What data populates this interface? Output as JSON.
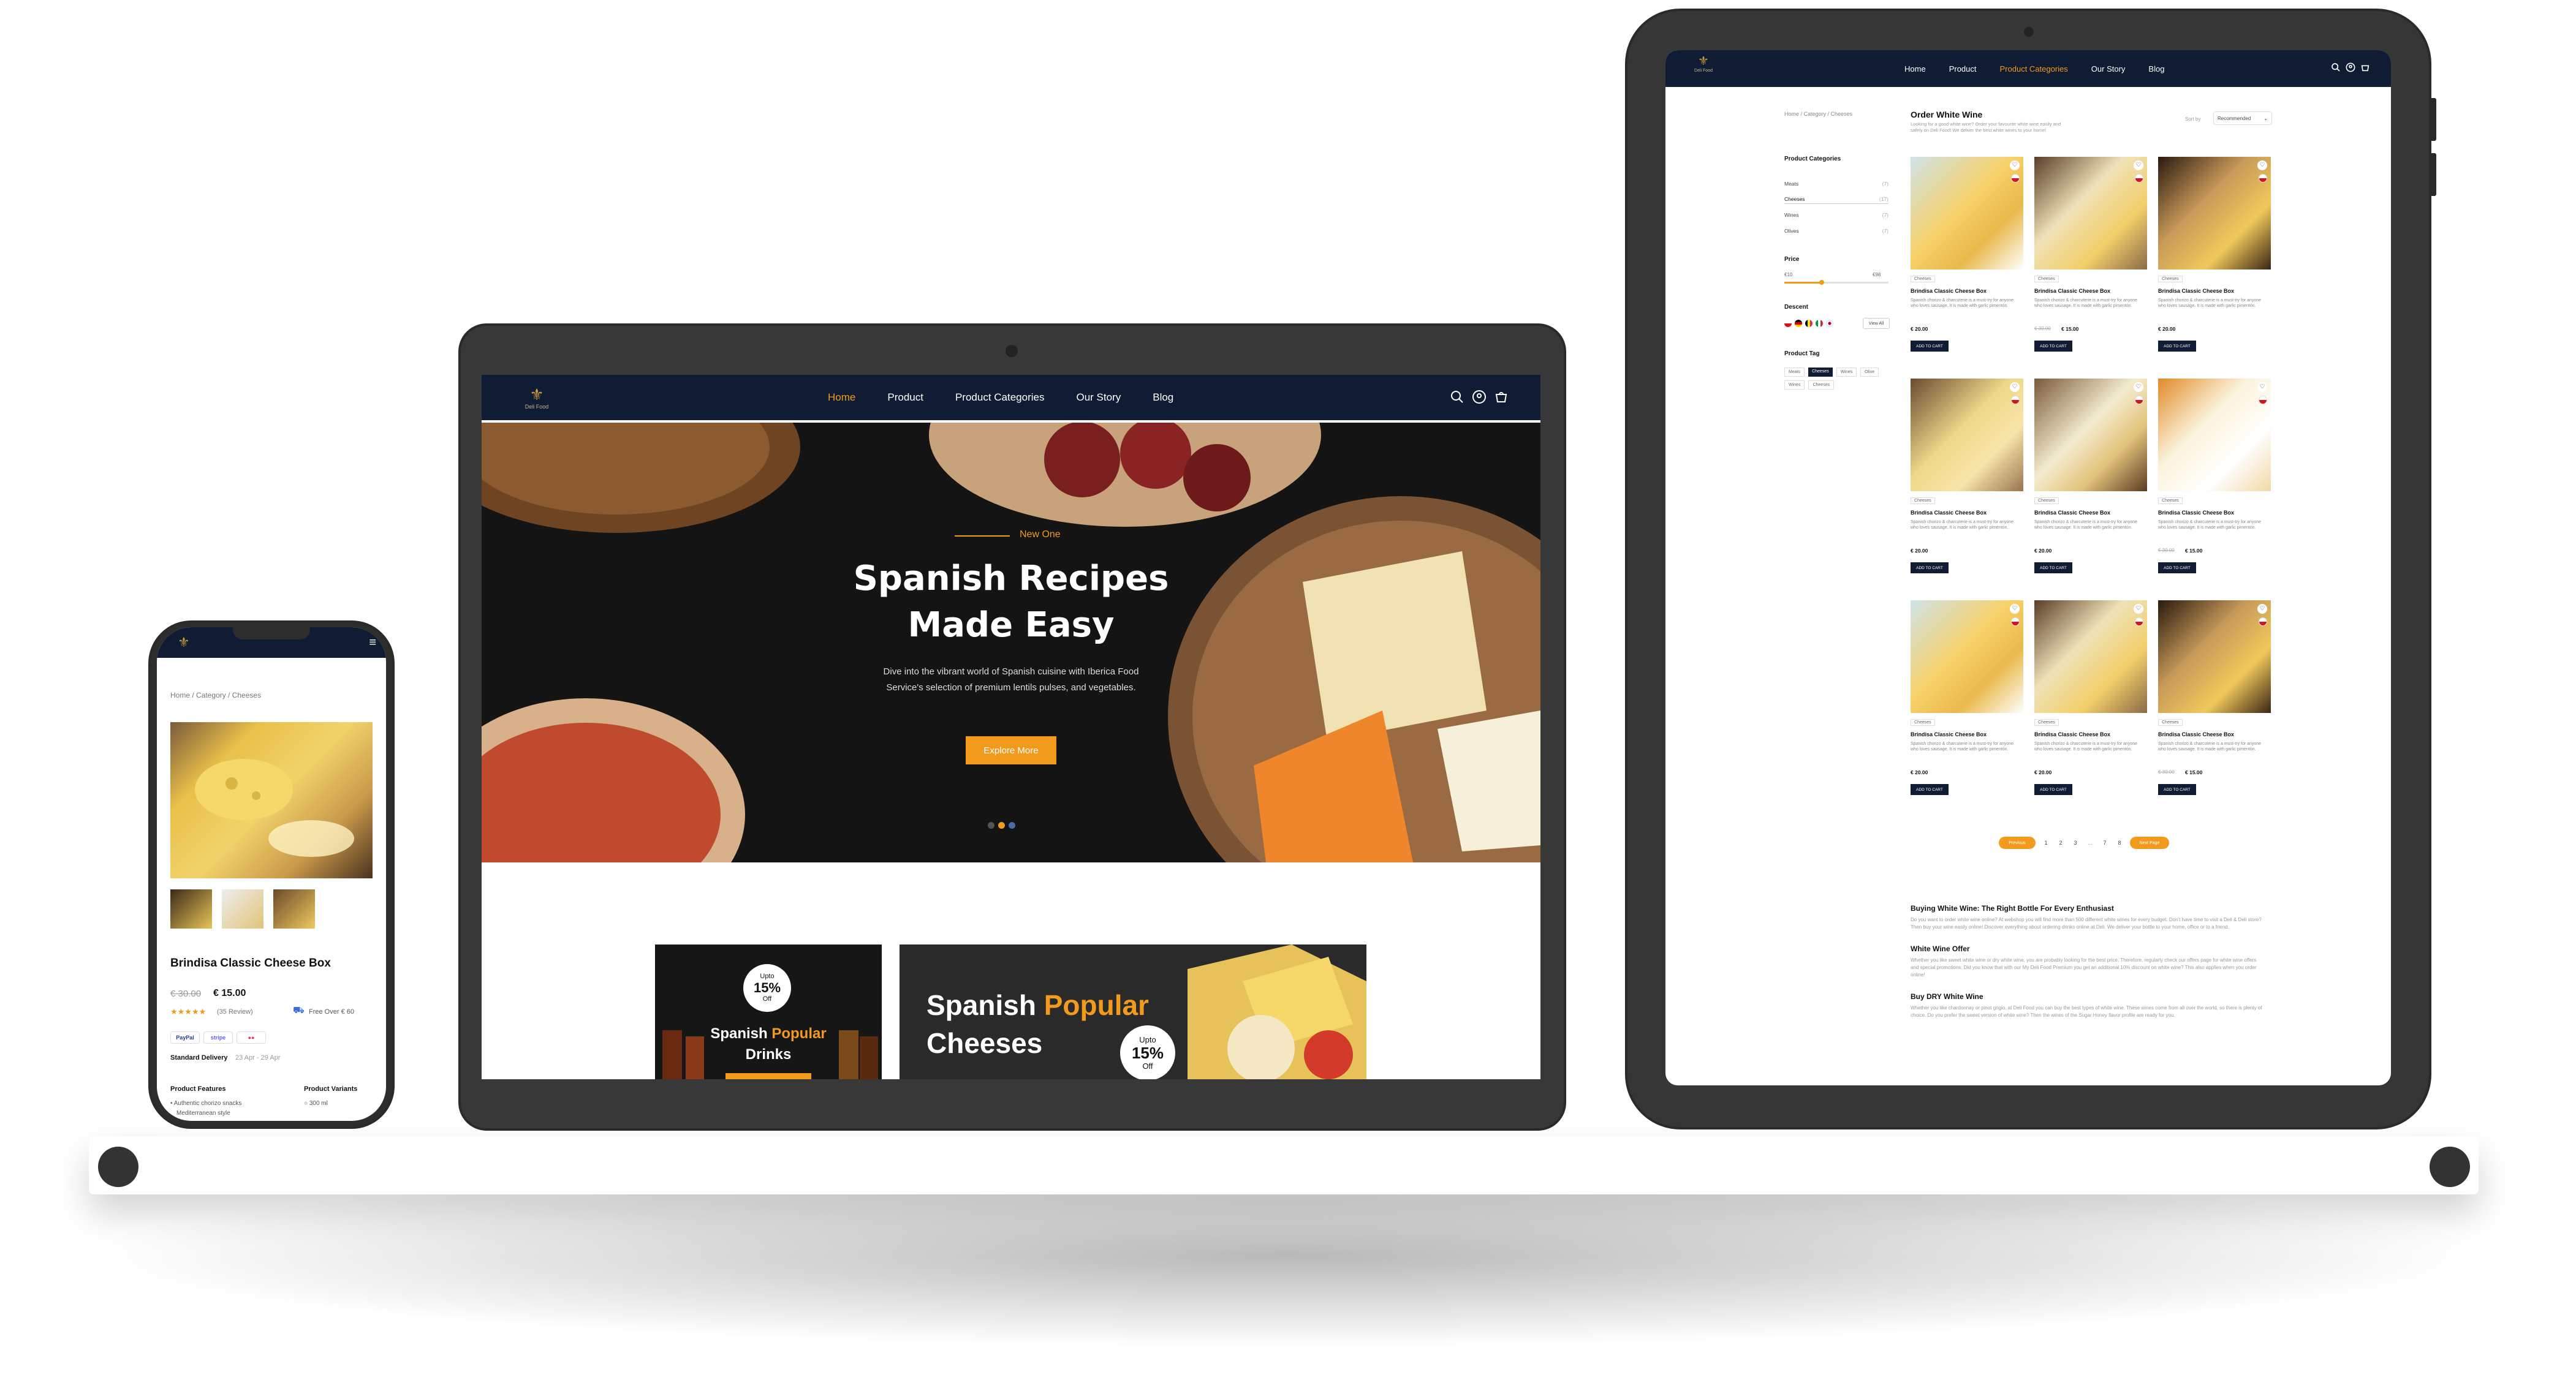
{
  "colors": {
    "navy": "#0f1c33",
    "accent": "#f29a1c",
    "frame": "#3a3a3a",
    "bodyText": "#8a8a8a"
  },
  "brand": {
    "name": "Deli Food",
    "logo_icon": "crest-logo-icon"
  },
  "nav": {
    "items": [
      "Home",
      "Product",
      "Product Categories",
      "Our Story",
      "Blog"
    ],
    "active_laptop": 0,
    "active_tablet": 2
  },
  "hero": {
    "eyebrow": "New One",
    "title_line1": "Spanish Recipes",
    "title_line2": "Made Easy",
    "desc": "Dive into the vibrant world of Spanish cuisine with Iberica Food Service's selection of premium lentils pulses, and vegetables.",
    "cta": "Explore More",
    "slides": 3,
    "active_slide": 1
  },
  "promos": [
    {
      "title_a": "Spanish ",
      "title_b": "Popular",
      "title_c": "Drinks",
      "badge_top": "Upto",
      "badge_pct": "15%",
      "badge_bottom": "Off"
    },
    {
      "title_a": "Spanish ",
      "title_b": "Popular",
      "title_c": "Cheeses",
      "badge_top": "Upto",
      "badge_pct": "15%",
      "badge_bottom": "Off"
    }
  ],
  "mobile": {
    "breadcrumb": "Home / Category / Cheeses",
    "product_title": "Brindisa Classic Cheese Box",
    "old_price": "€ 30.00",
    "price": "€ 15.00",
    "stars": "★★★★★",
    "reviews": "(35 Review)",
    "shipping": "Free Over € 60",
    "payments": [
      "PayPal",
      "stripe",
      "●●"
    ],
    "delivery_label": "Standard Delivery",
    "delivery_date": "23 Apr - 29 Apr",
    "features_label": "Product Features",
    "variants_label": "Product Variants",
    "feature_1": "Authentic chorizo snacks",
    "feature_2": "Mediterranean style",
    "variant_1": "300 ml"
  },
  "shop": {
    "breadcrumb": "Home / Category / Cheeses",
    "title": "Order White Wine",
    "intro": "Looking for a good white wine? Order your favourite white wine easily and safely on Deli Food! We deliver the best white wines to your home!",
    "sort_label": "Sort by",
    "sort_value": "Recommended",
    "categories_label": "Product Categories",
    "categories": [
      {
        "name": "Meats",
        "count": "(7)"
      },
      {
        "name": "Cheeses",
        "count": "(17)"
      },
      {
        "name": "Wines",
        "count": "(7)"
      },
      {
        "name": "Olives",
        "count": "(7)"
      }
    ],
    "price_label": "Price",
    "price_min": "€10",
    "price_max": "€98",
    "descent_label": "Descent",
    "view_all": "View All",
    "tag_label": "Product Tag",
    "tags": [
      "Meats",
      "Cheeses",
      "Wines",
      "Olive",
      "Wines",
      "Cheeses"
    ],
    "products": [
      {
        "cat": "Cheeses",
        "name": "Brindisa Classic Cheese Box",
        "desc": "Spanish chorizo & charcuterie is a must-try for anyone who loves sausage. It is made with garlic pimentón.",
        "old": "",
        "price": "€ 20.00",
        "cta": "ADD TO CART"
      },
      {
        "cat": "Cheeses",
        "name": "Brindisa Classic Cheese Box",
        "desc": "Spanish chorizo & charcuterie is a must-try for anyone who loves sausage. It is made with garlic pimentón.",
        "old": "€ 30.00",
        "price": "€ 15.00",
        "cta": "ADD TO CART"
      },
      {
        "cat": "Cheeses",
        "name": "Brindisa Classic Cheese Box",
        "desc": "Spanish chorizo & charcuterie is a must-try for anyone who loves sausage. It is made with garlic pimentón.",
        "old": "",
        "price": "€ 20.00",
        "cta": "ADD TO CART"
      },
      {
        "cat": "Cheeses",
        "name": "Brindisa Classic Cheese Box",
        "desc": "Spanish chorizo & charcuterie is a must-try for anyone who loves sausage. It is made with garlic pimentón.",
        "old": "",
        "price": "€ 20.00",
        "cta": "ADD TO CART"
      },
      {
        "cat": "Cheeses",
        "name": "Brindisa Classic Cheese Box",
        "desc": "Spanish chorizo & charcuterie is a must-try for anyone who loves sausage. It is made with garlic pimentón.",
        "old": "",
        "price": "€ 20.00",
        "cta": "ADD TO CART"
      },
      {
        "cat": "Cheeses",
        "name": "Brindisa Classic Cheese Box",
        "desc": "Spanish chorizo & charcuterie is a must-try for anyone who loves sausage. It is made with garlic pimentón.",
        "old": "€ 30.00",
        "price": "€ 15.00",
        "cta": "ADD TO CART"
      },
      {
        "cat": "Cheeses",
        "name": "Brindisa Classic Cheese Box",
        "desc": "Spanish chorizo & charcuterie is a must-try for anyone who loves sausage. It is made with garlic pimentón.",
        "old": "",
        "price": "€ 20.00",
        "cta": "ADD TO CART"
      },
      {
        "cat": "Cheeses",
        "name": "Brindisa Classic Cheese Box",
        "desc": "Spanish chorizo & charcuterie is a must-try for anyone who loves sausage. It is made with garlic pimentón.",
        "old": "",
        "price": "€ 20.00",
        "cta": "ADD TO CART"
      },
      {
        "cat": "Cheeses",
        "name": "Brindisa Classic Cheese Box",
        "desc": "Spanish chorizo & charcuterie is a must-try for anyone who loves sausage. It is made with garlic pimentón.",
        "old": "€ 30.00",
        "price": "€ 15.00",
        "cta": "ADD TO CART"
      }
    ],
    "pagination": {
      "prev": "Previous",
      "pages": [
        "1",
        "2",
        "3",
        "...",
        "7",
        "8"
      ],
      "next": "Next Page"
    },
    "article": [
      {
        "h": "Buying White Wine: The Right Bottle For Every Enthusiast",
        "p": "Do you want to order white wine online? At webshop you will find more than 500 different white wines for every budget. Don't have time to visit a Deli & Deli store? Then buy your wine easily online! Discover everything about ordering drinks online at Deli. We deliver your bottle to your home, office or to a friend."
      },
      {
        "h": "White Wine Offer",
        "p": "Whether you like sweet white wine or dry white wine, you are probably looking for the best price. Therefore, regularly check our offers page for white wine offers and special promotions. Did you know that with our My Deli Food Premium you get an additional 10% discount on white wine? This also applies when you order online!"
      },
      {
        "h": "Buy DRY White Wine",
        "p": "Whether you like chardonnay or pinot grigio, at Deli Food you can buy the best types of white wine. These wines come from all over the world, so there is plenty of choice. Do you prefer the sweet version of white wine? Then the wines of the Sugar Honey flavor profile are ready for you."
      }
    ]
  }
}
